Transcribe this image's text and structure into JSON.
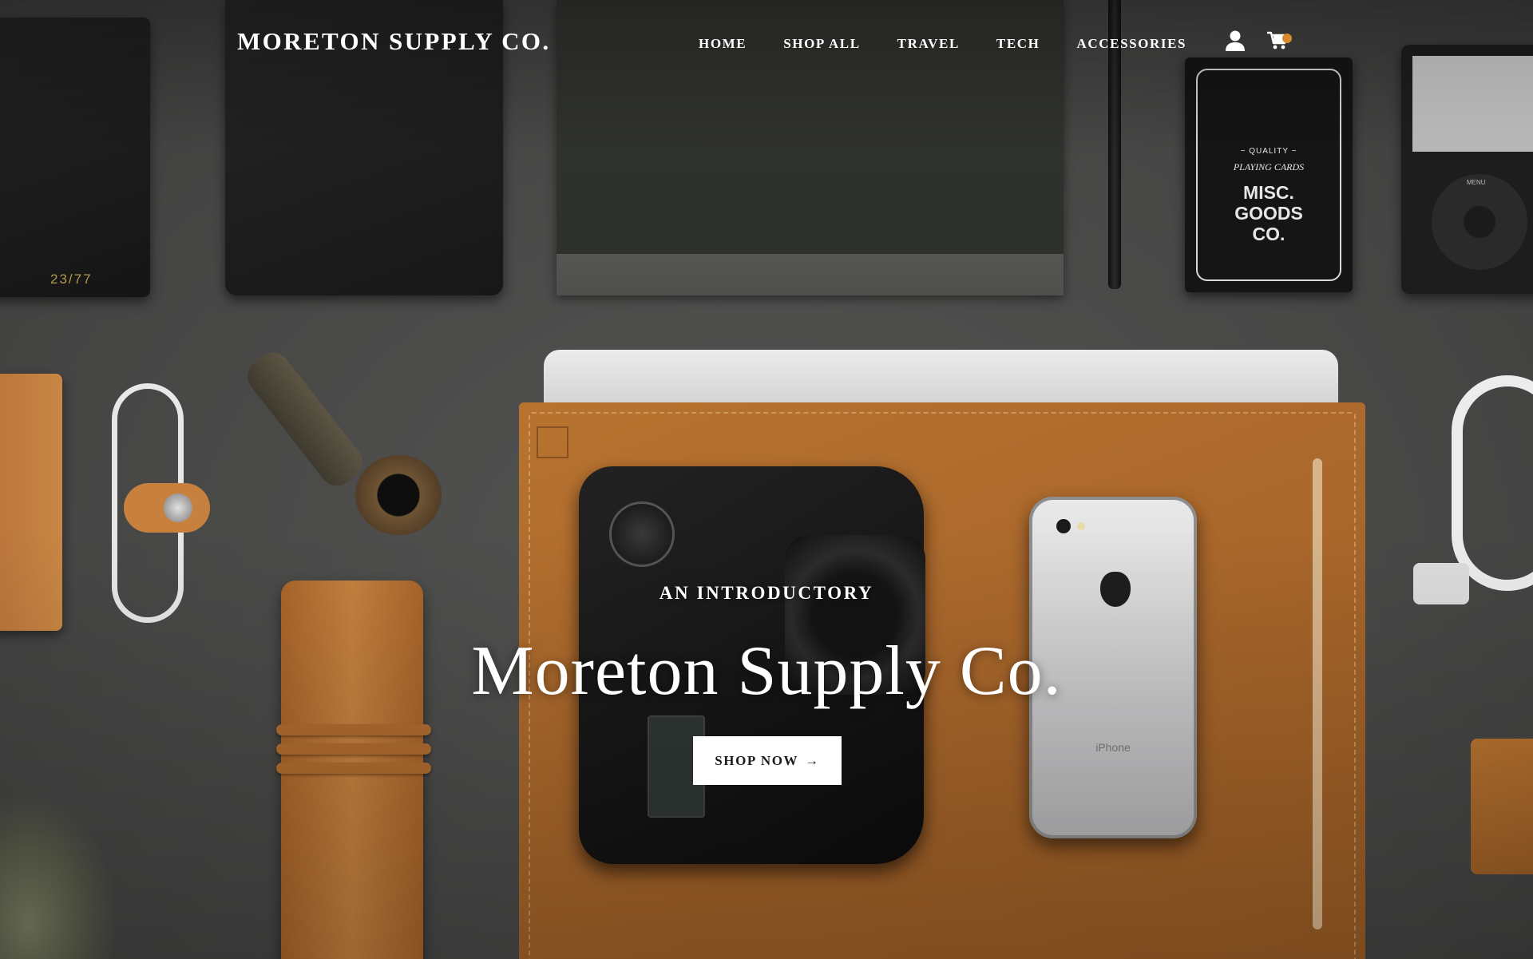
{
  "header": {
    "brand": "MORETON SUPPLY CO.",
    "nav": [
      {
        "label": "HOME"
      },
      {
        "label": "SHOP ALL"
      },
      {
        "label": "TRAVEL"
      },
      {
        "label": "TECH"
      },
      {
        "label": "ACCESSORIES"
      }
    ],
    "icons": {
      "account": "user-icon",
      "cart": "cart-icon"
    },
    "cart_indicator_color": "#d8892e"
  },
  "hero": {
    "kicker": "AN INTRODUCTORY",
    "title": "Moreton Supply Co.",
    "cta_label": "SHOP NOW",
    "cta_arrow": "→"
  },
  "scene_text": {
    "notebook_number": "23/77",
    "cards_line1": "~ QUALITY ~",
    "cards_line2": "PLAYING CARDS",
    "cards_brand": [
      "MISC.",
      "GOODS",
      "CO."
    ],
    "phone_word": "iPhone",
    "ipod_menu": "MENU"
  },
  "colors": {
    "text": "#ffffff",
    "button_bg": "#ffffff",
    "button_text": "#1b1b1b",
    "leather": "#b87330",
    "background": "#4b4b4a"
  }
}
